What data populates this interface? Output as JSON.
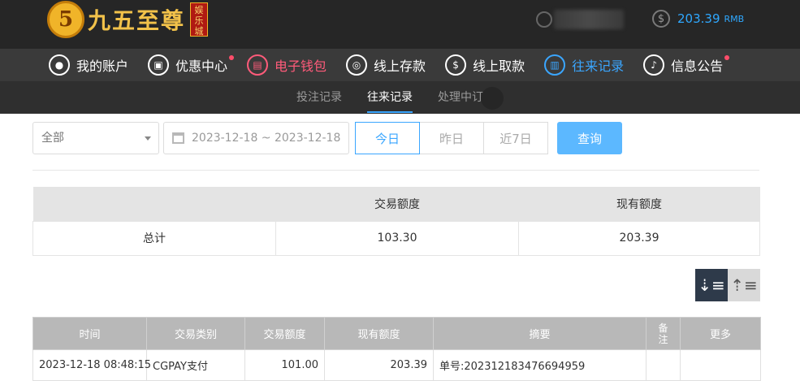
{
  "header": {
    "logo_mark": "5",
    "logo_text": "九五至尊",
    "logo_badge": "娱乐城",
    "balance_value": "203.39",
    "balance_currency": "RMB",
    "dollar_icon": "$"
  },
  "nav": {
    "items": [
      {
        "label": "我的账户",
        "icon": "user-icon"
      },
      {
        "label": "优惠中心",
        "icon": "gift-icon"
      },
      {
        "label": "电子钱包",
        "icon": "wallet-icon"
      },
      {
        "label": "线上存款",
        "icon": "deposit-icon"
      },
      {
        "label": "线上取款",
        "icon": "withdraw-icon"
      },
      {
        "label": "往来记录",
        "icon": "records-icon"
      },
      {
        "label": "信息公告",
        "icon": "bell-icon"
      }
    ]
  },
  "subtabs": {
    "items": [
      {
        "label": "投注记录"
      },
      {
        "label": "往来记录"
      },
      {
        "label": "处理中订"
      }
    ]
  },
  "filters": {
    "type_select": "全部",
    "date_range": "2023-12-18 ~ 2023-12-18",
    "quick_ranges": [
      "今日",
      "昨日",
      "近7日"
    ],
    "query_label": "查询"
  },
  "summary": {
    "headers": [
      "",
      "交易额度",
      "现有额度"
    ],
    "row": [
      "总计",
      "103.30",
      "203.39"
    ]
  },
  "records": {
    "headers": [
      "时间",
      "交易类别",
      "交易额度",
      "现有额度",
      "摘要",
      "备注",
      "更多"
    ],
    "rows": [
      [
        "2023-12-18 08:48:15",
        "CGPAY支付",
        "101.00",
        "203.39",
        "单号:202312183476694959",
        "",
        ""
      ]
    ]
  },
  "colors": {
    "accent_blue": "#3aa6ff",
    "accent_red": "#ff5b7a",
    "header_bg": "#262626",
    "nav_bg": "#3a3a3a"
  }
}
